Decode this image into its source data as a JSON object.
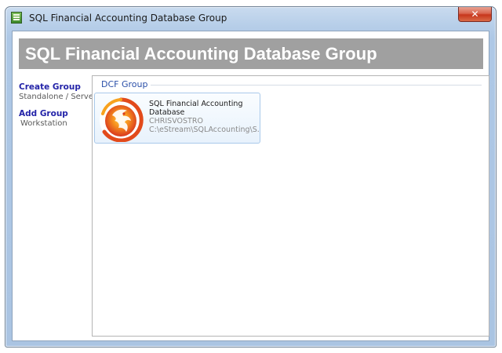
{
  "window": {
    "title": "SQL Financial Accounting Database Group",
    "close_glyph": "✕"
  },
  "banner": {
    "title": "SQL Financial Accounting Database Group"
  },
  "sidebar": {
    "items": [
      {
        "title": "Create Group",
        "subtitle": "Standalone / Server"
      },
      {
        "title": "Add Group",
        "subtitle": "Workstation"
      }
    ]
  },
  "group": {
    "label": "DCF Group",
    "databases": [
      {
        "name": "SQL Financial Accounting Database",
        "host": "CHRISVOSTRO",
        "path": "C:\\eStream\\SQLAccounting\\S..."
      }
    ]
  },
  "icons": {
    "app": "app-icon",
    "close": "close-icon",
    "database_logo": "firebird-icon"
  },
  "colors": {
    "banner_bg": "#a0a0a0",
    "banner_text": "#ffffff",
    "link_text": "#2323a8",
    "group_label": "#2a4fa8",
    "close_button": "#c7361c"
  }
}
